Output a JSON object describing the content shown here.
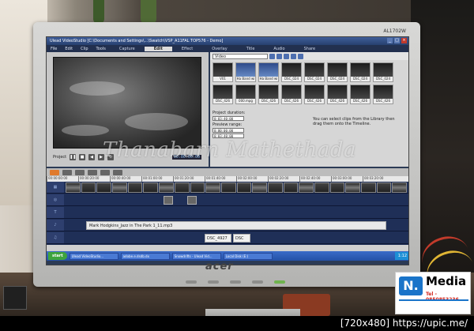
{
  "monitor": {
    "brand": "acer",
    "model": "AL1702W"
  },
  "app": {
    "window_title": "Ulead VideoStudio [C:\\Documents and Settings\\...\\Swatch\\VSP_A11FAL TOP576 - Demo]",
    "menu": [
      "File",
      "Edit",
      "Clip",
      "Tools"
    ],
    "steps": [
      "Capture",
      "Edit",
      "Effect",
      "Overlay",
      "Title",
      "Audio",
      "Share"
    ],
    "active_step": "Edit"
  },
  "preview": {
    "timecode": "00:00:00:00",
    "mode": "Project"
  },
  "library": {
    "category": "Video",
    "thumbs": [
      {
        "label": "V01",
        "style": "dark"
      },
      {
        "label": "Ha Band wi",
        "style": "blue"
      },
      {
        "label": "Ha Band wi",
        "style": "blue"
      },
      {
        "label": "DSC_024",
        "style": "dark"
      },
      {
        "label": "DSC_024",
        "style": "dark"
      },
      {
        "label": "DSC_024",
        "style": "dark"
      },
      {
        "label": "DSC_024",
        "style": "dark"
      },
      {
        "label": "DSC_024",
        "style": "dark"
      },
      {
        "label": "DSC_426",
        "style": "dark"
      },
      {
        "label": "000.mpg",
        "style": "dark"
      },
      {
        "label": "DSC_426",
        "style": "dark"
      },
      {
        "label": "DSC_426",
        "style": "dark"
      },
      {
        "label": "DSC_426",
        "style": "dark"
      },
      {
        "label": "DSC_426",
        "style": "dark"
      },
      {
        "label": "DSC_426",
        "style": "dark"
      },
      {
        "label": "DSC_426",
        "style": "dark"
      }
    ],
    "project_duration_label": "Project duration:",
    "project_duration": "0:03:40:00",
    "preview_range_label": "Preview range:",
    "range_start": "0:00:00:00",
    "range_end": "0:03:40:00",
    "hint": "You can select clips from the Library then drag them onto the Timeline."
  },
  "timeline": {
    "ruler": [
      "00:00:00:00",
      "00:00:20:00",
      "00:00:40:00",
      "00:01:00:00",
      "00:01:20:00",
      "00:01:40:00",
      "00:02:00:00",
      "00:02:20:00",
      "00:02:40:00",
      "00:03:00:00",
      "00:03:20:00"
    ],
    "music_clip": "Mark Hodgkins_Jazz in The Park 1_11.mp3",
    "sound_clips": [
      "DSC_4927",
      "DSC"
    ]
  },
  "taskbar": {
    "start": "start",
    "items": [
      "Ulead VideoStudio...",
      "adobe.e.dsdb.dx",
      "Snowdrifts - Ulead Vid...",
      "Local Disk (E:)"
    ],
    "clock": "1:12"
  },
  "watermark": "Thanabarn Mathethada",
  "logo": {
    "mark": "N.",
    "name": "Media",
    "tel": "Tel - 0850853236"
  },
  "credit": "[720x480] https://upic.me/"
}
